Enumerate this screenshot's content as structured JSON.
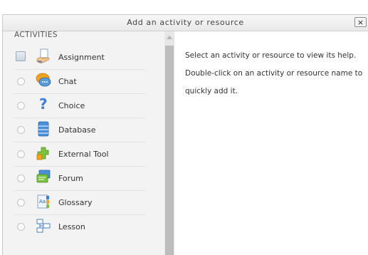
{
  "dialog": {
    "title": "Add an activity or resource",
    "close_label": "×"
  },
  "activities": {
    "heading": "ACTIVITIES",
    "items": [
      {
        "label": "Assignment",
        "icon": "assignment-icon",
        "selected": true
      },
      {
        "label": "Chat",
        "icon": "chat-icon",
        "selected": false
      },
      {
        "label": "Choice",
        "icon": "choice-icon",
        "selected": false
      },
      {
        "label": "Database",
        "icon": "database-icon",
        "selected": false
      },
      {
        "label": "External Tool",
        "icon": "external-tool-icon",
        "selected": false
      },
      {
        "label": "Forum",
        "icon": "forum-icon",
        "selected": false
      },
      {
        "label": "Glossary",
        "icon": "glossary-icon",
        "selected": false
      },
      {
        "label": "Lesson",
        "icon": "lesson-icon",
        "selected": false
      }
    ]
  },
  "help": {
    "line1": "Select an activity or resource to view its help.",
    "line2": "Double-click on an activity or resource name to quickly add it."
  }
}
